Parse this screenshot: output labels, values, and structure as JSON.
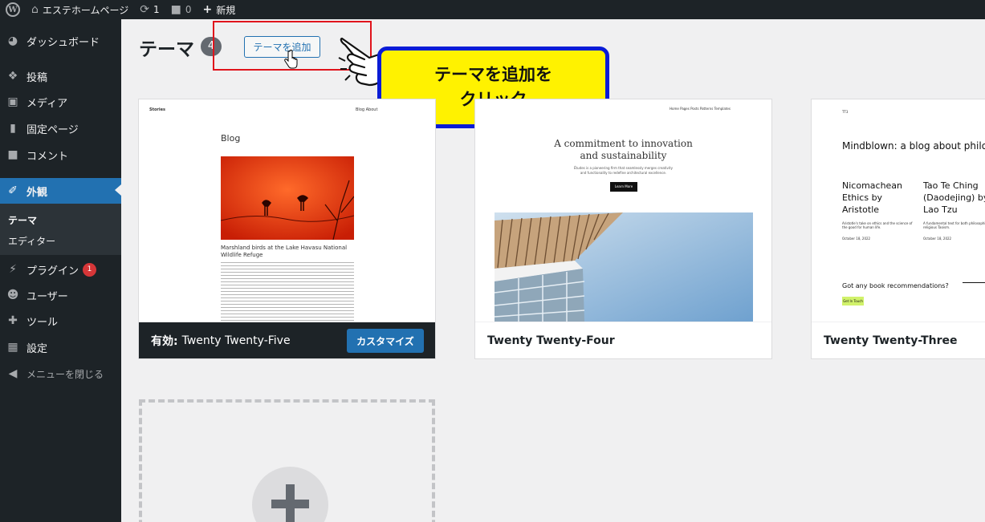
{
  "admin_bar": {
    "site_name": "エステホームページ",
    "updates_count": "1",
    "comments_count": "0",
    "new_label": "新規"
  },
  "sidebar": {
    "items": [
      {
        "label": "ダッシュボード",
        "icon": "dashboard-icon"
      },
      {
        "label": "投稿",
        "icon": "pin-icon"
      },
      {
        "label": "メディア",
        "icon": "media-icon"
      },
      {
        "label": "固定ページ",
        "icon": "page-icon"
      },
      {
        "label": "コメント",
        "icon": "comment-icon"
      },
      {
        "label": "外観",
        "icon": "brush-icon"
      },
      {
        "label": "プラグイン",
        "icon": "plugin-icon",
        "badge": "1"
      },
      {
        "label": "ユーザー",
        "icon": "user-icon"
      },
      {
        "label": "ツール",
        "icon": "wrench-icon"
      },
      {
        "label": "設定",
        "icon": "settings-icon"
      }
    ],
    "submenu": [
      "テーマ",
      "エディター"
    ],
    "collapse_label": "メニューを閉じる"
  },
  "header": {
    "title": "テーマ",
    "count": "4",
    "add_button": "テーマを追加"
  },
  "callout": {
    "line1": "テーマを追加を",
    "line2": "クリック"
  },
  "themes": [
    {
      "name": "Twenty Twenty-Five",
      "active_label": "有効:",
      "customize_label": "カスタマイズ",
      "preview": {
        "site": "Stories",
        "nav": "Blog  About",
        "heading": "Blog",
        "post_title": "Marshland birds at the Lake Havasu National Wildlife Refuge"
      }
    },
    {
      "name": "Twenty Twenty-Four",
      "preview": {
        "nav": "Home   Pages   Posts   Patterns   Templates",
        "headline1": "A commitment to innovation",
        "headline2": "and sustainability",
        "sub1": "Études is a pioneering firm that seamlessly merges creativity",
        "sub2": "and functionality to redefine architectural excellence.",
        "button": "Learn More"
      }
    },
    {
      "name": "Twenty Twenty-Three",
      "preview": {
        "site": "TT3",
        "headline": "Mindblown: a blog about philo",
        "post1": "Nicomachean Ethics by Aristotle",
        "post2": "Tao Te Ching (Daodejing) by Lao Tzu",
        "excerpt1": "Aristotle's take on ethics and the science of the good for human life.",
        "excerpt2": "A fundamental text for both philosophical and religious Taoism.",
        "date1": "October 18, 2022",
        "date2": "October 18, 2022",
        "question": "Got any book recommendations?",
        "button": "Get In Touch"
      }
    }
  ],
  "colors": {
    "admin_dark": "#1d2327",
    "accent_blue": "#2271b1",
    "highlight_red": "#e0141c",
    "callout_yellow": "#fff200",
    "callout_border": "#0a1cd6"
  }
}
